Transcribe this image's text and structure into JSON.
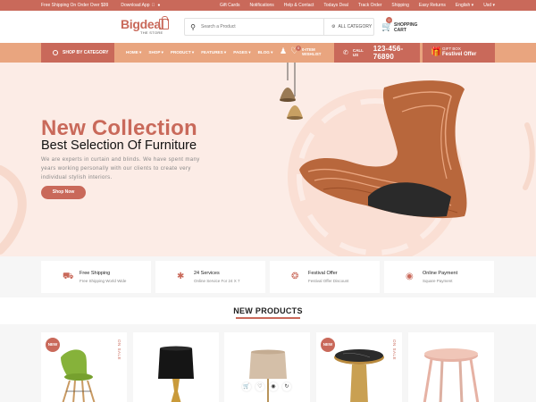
{
  "topbar": {
    "shipping_note": "Free Shipping On Order Over $99",
    "download_app": "Download App",
    "links": [
      "Gift Cards",
      "Notifications",
      "Help & Contact",
      "Todays Deal",
      "Track Order",
      "Shipping",
      "Easy Returns",
      "English",
      "Usd"
    ]
  },
  "header": {
    "logo_name": "Bigdeal",
    "logo_tag": "THE STORE",
    "search_placeholder": "Search a Product",
    "category_select": "ALL CATEGORY",
    "cart_count": "0",
    "cart_label": "SHOPPING CART"
  },
  "nav": {
    "shop_by_category": "SHOP BY CATEGORY",
    "menu": [
      "HOME",
      "SHOP",
      "PRODUCT",
      "FEATURES",
      "PAGES",
      "BLOG"
    ],
    "wishlist_count": "0",
    "wishlist_label": "0-ITEM WISHLIST",
    "call_label": "CALL US",
    "phone": "123-456-76890",
    "gift_small": "GIFT BOX",
    "gift_big": "Festivel Offer"
  },
  "hero": {
    "title": "New Collection",
    "subtitle": "Best Selection Of Furniture",
    "description": "We are experts in curtain and blinds. We have spent many years working personally with our clients to create very individual stylish interiors.",
    "button": "Shop Now"
  },
  "features": [
    {
      "icon": "truck-icon",
      "title": "Free Shipping",
      "subtitle": "Free Shipping World Wide"
    },
    {
      "icon": "support-icon",
      "title": "24 Services",
      "subtitle": "Online Service For 24 X 7"
    },
    {
      "icon": "discount-icon",
      "title": "Festival Offer",
      "subtitle": "Festival Offer Discount"
    },
    {
      "icon": "payment-icon",
      "title": "Online Payment",
      "subtitle": "Square Payment"
    }
  ],
  "section_title": "NEW PRODUCTS",
  "products": [
    {
      "name": "green chair",
      "badge": "NEW",
      "sale": "ON SALE"
    },
    {
      "name": "table lamp",
      "badge": "",
      "sale": ""
    },
    {
      "name": "floor lamp",
      "badge": "",
      "sale": ""
    },
    {
      "name": "marble side table",
      "badge": "NEW",
      "sale": "ON SALE"
    },
    {
      "name": "pink stool",
      "badge": "",
      "sale": ""
    }
  ],
  "colors": {
    "accent": "#c9695a",
    "nav_bg": "#e9a57f",
    "hero_bg": "#fcece6"
  }
}
